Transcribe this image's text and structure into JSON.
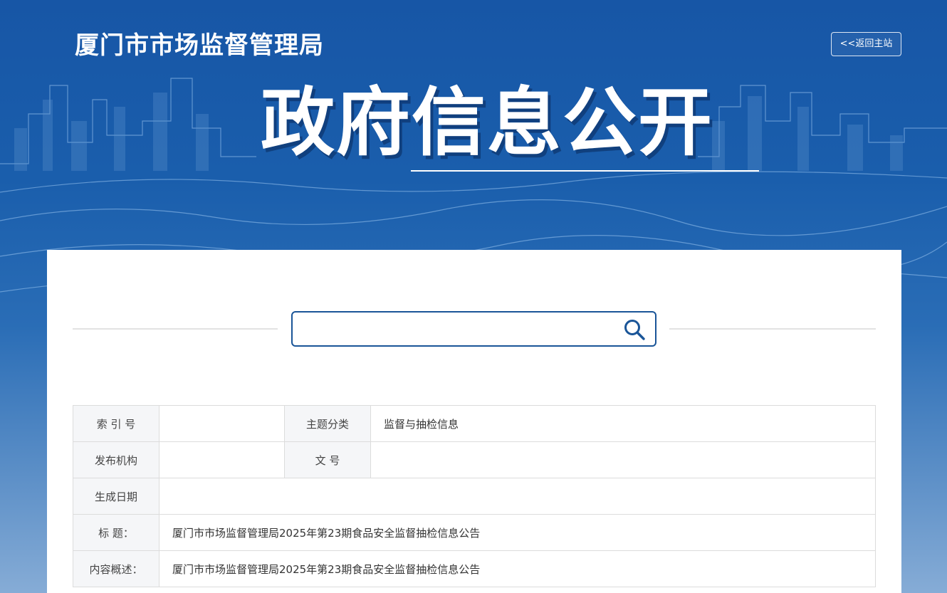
{
  "header": {
    "site_name": "厦门市市场监督管理局",
    "back_link": "<<返回主站",
    "hero_title": "政府信息公开"
  },
  "search": {
    "placeholder": "",
    "value": ""
  },
  "meta_table": {
    "index_label": "索 引 号",
    "index_value": "",
    "category_label": "主题分类",
    "category_value": "监督与抽检信息",
    "publisher_label": "发布机构",
    "publisher_value": "",
    "doc_no_label": "文 号",
    "doc_no_value": "",
    "date_label": "生成日期",
    "date_value": "",
    "title_label": "标 题：",
    "title_value": "厦门市市场监督管理局2025年第23期食品安全监督抽检信息公告",
    "summary_label": "内容概述：",
    "summary_value": "厦门市市场监督管理局2025年第23期食品安全监督抽检信息公告"
  },
  "colors": {
    "brand_blue": "#1a5ea8",
    "search_border": "#1a5598",
    "label_bg": "#f5f6f8"
  },
  "icons": {
    "search": "search-icon"
  }
}
